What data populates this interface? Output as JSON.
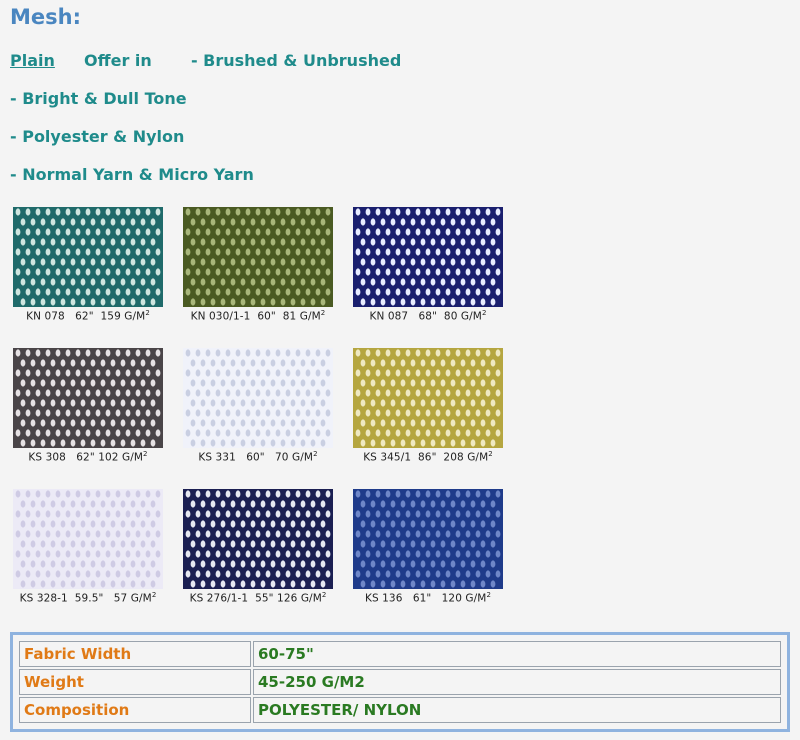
{
  "page": {
    "title": "Mesh:"
  },
  "features": {
    "plain_link": "Plain",
    "offer_in": "Offer in",
    "line1": "- Brushed & Unbrushed",
    "line2": "- Bright & Dull Tone",
    "line3": "- Polyester & Nylon",
    "line4": "- Normal Yarn & Micro Yarn"
  },
  "swatches": [
    {
      "code": "KN 078",
      "width": "62\"",
      "weight": "159 G/M",
      "exp": "2",
      "colors": {
        "bg": "#1f6a6a",
        "hole": "#cfe6e0"
      }
    },
    {
      "code": "KN 030/1-1",
      "width": "60\"",
      "weight": "81 G/M",
      "exp": "2",
      "colors": {
        "bg": "#4a5a22",
        "hole": "#a8b67a"
      }
    },
    {
      "code": "KN 087",
      "width": "68\"",
      "weight": "80 G/M",
      "exp": "2",
      "colors": {
        "bg": "#1a1f6e",
        "hole": "#e8ecff"
      }
    },
    {
      "code": "KS 308",
      "width": "62\"",
      "weight": "102 G/M",
      "exp": "2",
      "colors": {
        "bg": "#4a4548",
        "hole": "#e6e2e4"
      }
    },
    {
      "code": "KS 331",
      "width": "60\"",
      "weight": "70 G/M",
      "exp": "2",
      "colors": {
        "bg": "#f0f2fa",
        "hole": "#c9cfe2"
      }
    },
    {
      "code": "KS 345/1",
      "width": "86\"",
      "weight": "208 G/M",
      "exp": "2",
      "colors": {
        "bg": "#b5a640",
        "hole": "#efe9c2"
      }
    },
    {
      "code": "KS 328-1",
      "width": "59.5\"",
      "weight": "57 G/M",
      "exp": "2",
      "colors": {
        "bg": "#eceaf6",
        "hole": "#cfcbe4"
      }
    },
    {
      "code": "KS 276/1-1",
      "width": "55\"",
      "weight": "126 G/M",
      "exp": "2",
      "colors": {
        "bg": "#1b1f52",
        "hole": "#e6e8f2"
      }
    },
    {
      "code": "KS 136",
      "width": "61\"",
      "weight": "120 G/M",
      "exp": "2",
      "colors": {
        "bg": "#1f3b8a",
        "hole": "#6f87c8"
      }
    }
  ],
  "specs": [
    {
      "label": "Fabric Width",
      "value": "60-75\""
    },
    {
      "label": "Weight",
      "value": "45-250 G/M2"
    },
    {
      "label": "Composition",
      "value": "POLYESTER/ NYLON"
    }
  ]
}
